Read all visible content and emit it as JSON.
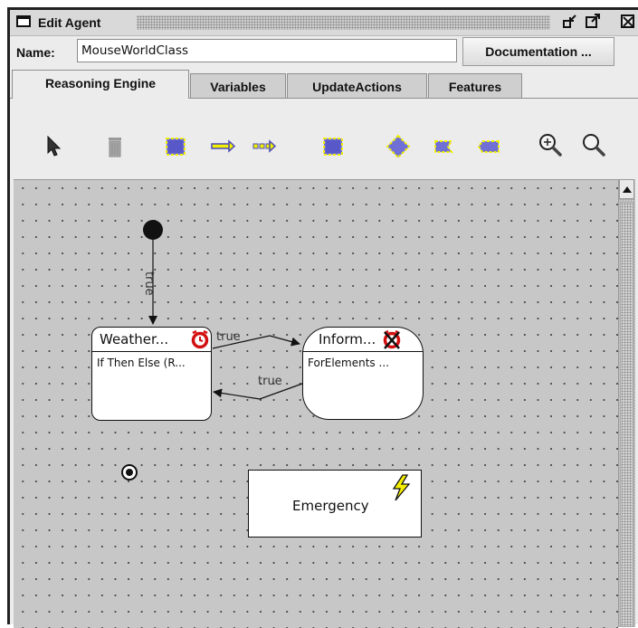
{
  "window": {
    "title": "Edit Agent"
  },
  "name_field": {
    "label": "Name:",
    "value": "MouseWorldClass"
  },
  "documentation_button": {
    "label": "Documentation ..."
  },
  "tabs": [
    {
      "label": "Reasoning Engine",
      "active": true
    },
    {
      "label": "Variables",
      "active": false
    },
    {
      "label": "UpdateActions",
      "active": false
    },
    {
      "label": "Features",
      "active": false
    }
  ],
  "toolbar": {
    "tools": [
      "select-arrow-icon",
      "delete-trash-icon",
      "add-state-icon",
      "add-transition-icon",
      "add-dashed-transition-icon",
      "add-composite-state-icon",
      "add-choice-icon",
      "add-entry-point-icon",
      "add-exit-point-icon",
      "zoom-in-icon",
      "zoom-out-icon"
    ]
  },
  "diagram": {
    "states": [
      {
        "name": "Weather...",
        "action": "If Then Else (R...",
        "icon": "timer-icon"
      },
      {
        "name": "Inform...",
        "action": "ForElements ...",
        "icon": "timer-disabled-icon"
      }
    ],
    "event_state": {
      "name": "Emergency",
      "icon": "lightning-icon"
    },
    "transitions": [
      {
        "label": "true",
        "from": "initial",
        "to": "Weather..."
      },
      {
        "label": "true",
        "from": "Weather...",
        "to": "Inform..."
      },
      {
        "label": "true",
        "from": "Inform...",
        "to": "Weather..."
      }
    ]
  },
  "colors": {
    "canvas": "#c7c7c7",
    "timer_red": "#d21010",
    "lightning_yellow": "#f5f000",
    "selection_yellow": "#f2f000"
  }
}
